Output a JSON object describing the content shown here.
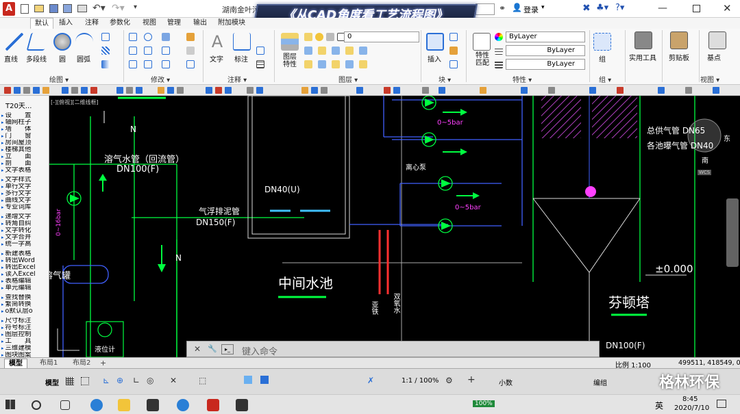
{
  "window": {
    "title": "湖南金叶污水",
    "search_placeholder": "",
    "login": "登录",
    "banner": "《从CAD角度看工艺流程图》"
  },
  "ribbon_tabs": [
    "默认",
    "插入",
    "注释",
    "参数化",
    "视图",
    "管理",
    "输出",
    "附加模块"
  ],
  "ribbon": {
    "draw": {
      "line": "直线",
      "polyline": "多段线",
      "circle": "圆",
      "arc": "圆弧",
      "group": "绘图 ▾"
    },
    "modify": {
      "group": "修改 ▾"
    },
    "annotation": {
      "text": "文字",
      "dimension": "标注",
      "group": "注释 ▾"
    },
    "layers": {
      "layer_props": "图层特性",
      "layer_value": "0",
      "group": "图层 ▾"
    },
    "block": {
      "insert": "插入",
      "group": "块 ▾"
    },
    "properties": {
      "match": "特性匹配",
      "props": "特性",
      "color": "ByLayer",
      "linetype": "ByLayer",
      "lineweight": "ByLayer",
      "group": "特性 ▾"
    },
    "groups": {
      "group": "组",
      "label": "组 ▾"
    },
    "utilities": {
      "label": "实用工具"
    },
    "clipboard": {
      "label": "剪贴板"
    },
    "view": {
      "base": "基点",
      "label": "视图 ▾"
    }
  },
  "left_panel": {
    "title": "T20天...",
    "items": [
      "设　　置",
      "轴网柱子",
      "墙　　体",
      "门　　窗",
      "房间屋顶",
      "楼梯其他",
      "立　　面",
      "剖　　面",
      "文字表格",
      "文字样式",
      "单行文字",
      "多行文字",
      "曲线文字",
      "专业词库",
      "递增文字",
      "转角自纠",
      "文字转化",
      "文字合并",
      "统一字高",
      "新建表格",
      "转出Word",
      "转出Excel",
      "读入Excel",
      "表格编辑",
      "单元编辑",
      "查找替换",
      "繁简转换",
      "o默认层o",
      "尺寸标注",
      "符号标注",
      "图层控制",
      "工　　具",
      "三维建模",
      "图块图案"
    ]
  },
  "canvas": {
    "viewport_label": "[-][俯视][二维线框]",
    "labels": {
      "pipe_n_top": "N",
      "dissolved_pipe": "溶气水管（回流管）",
      "dn100f": "DN100(F)",
      "flotation_pipe": "气浮排泥管",
      "dn150": "DN150(F)",
      "dn40u": "DN40(U)",
      "n_bottom": "N",
      "tank": "溶气罐",
      "mid_pool": "中间水池",
      "pressure_range_1": "0~5bar",
      "pressure_range_2": "0~5bar",
      "pump": "离心泵",
      "pressure_left": "0~16bar",
      "total_air": "总供气管 DN65",
      "aeration": "各池曝气管 DN40",
      "level": "±0.000",
      "fenton": "芬顿塔",
      "dn100f_bottom": "DN100(F)",
      "liquid_level": "液位计",
      "vert_a": "亚铁",
      "vert_b": "双氧水",
      "compass_e": "东",
      "compass_s": "南",
      "wcs": "WCS"
    }
  },
  "command_line": {
    "placeholder": "键入命令"
  },
  "layout_tabs": [
    "模型",
    "布局1",
    "布局2"
  ],
  "status": {
    "scale": "比例 1:100",
    "coords": "499511, 418549, 0.0000",
    "model": "模型",
    "annoscale": "1:1 / 100%",
    "decimal": "小数",
    "weaving": "编组",
    "watermark": "格林环保"
  },
  "taskbar": {
    "battery": "100%",
    "ime": "英",
    "time": "8:45",
    "date": "2020/7/10"
  },
  "colors": {
    "canvas": "#000000",
    "pipe_green": "#00ff40",
    "pipe_blue": "#2020ff",
    "pipe_yellow": "#ffff00",
    "red": "#ff2020",
    "magenta": "#ff40ff"
  }
}
